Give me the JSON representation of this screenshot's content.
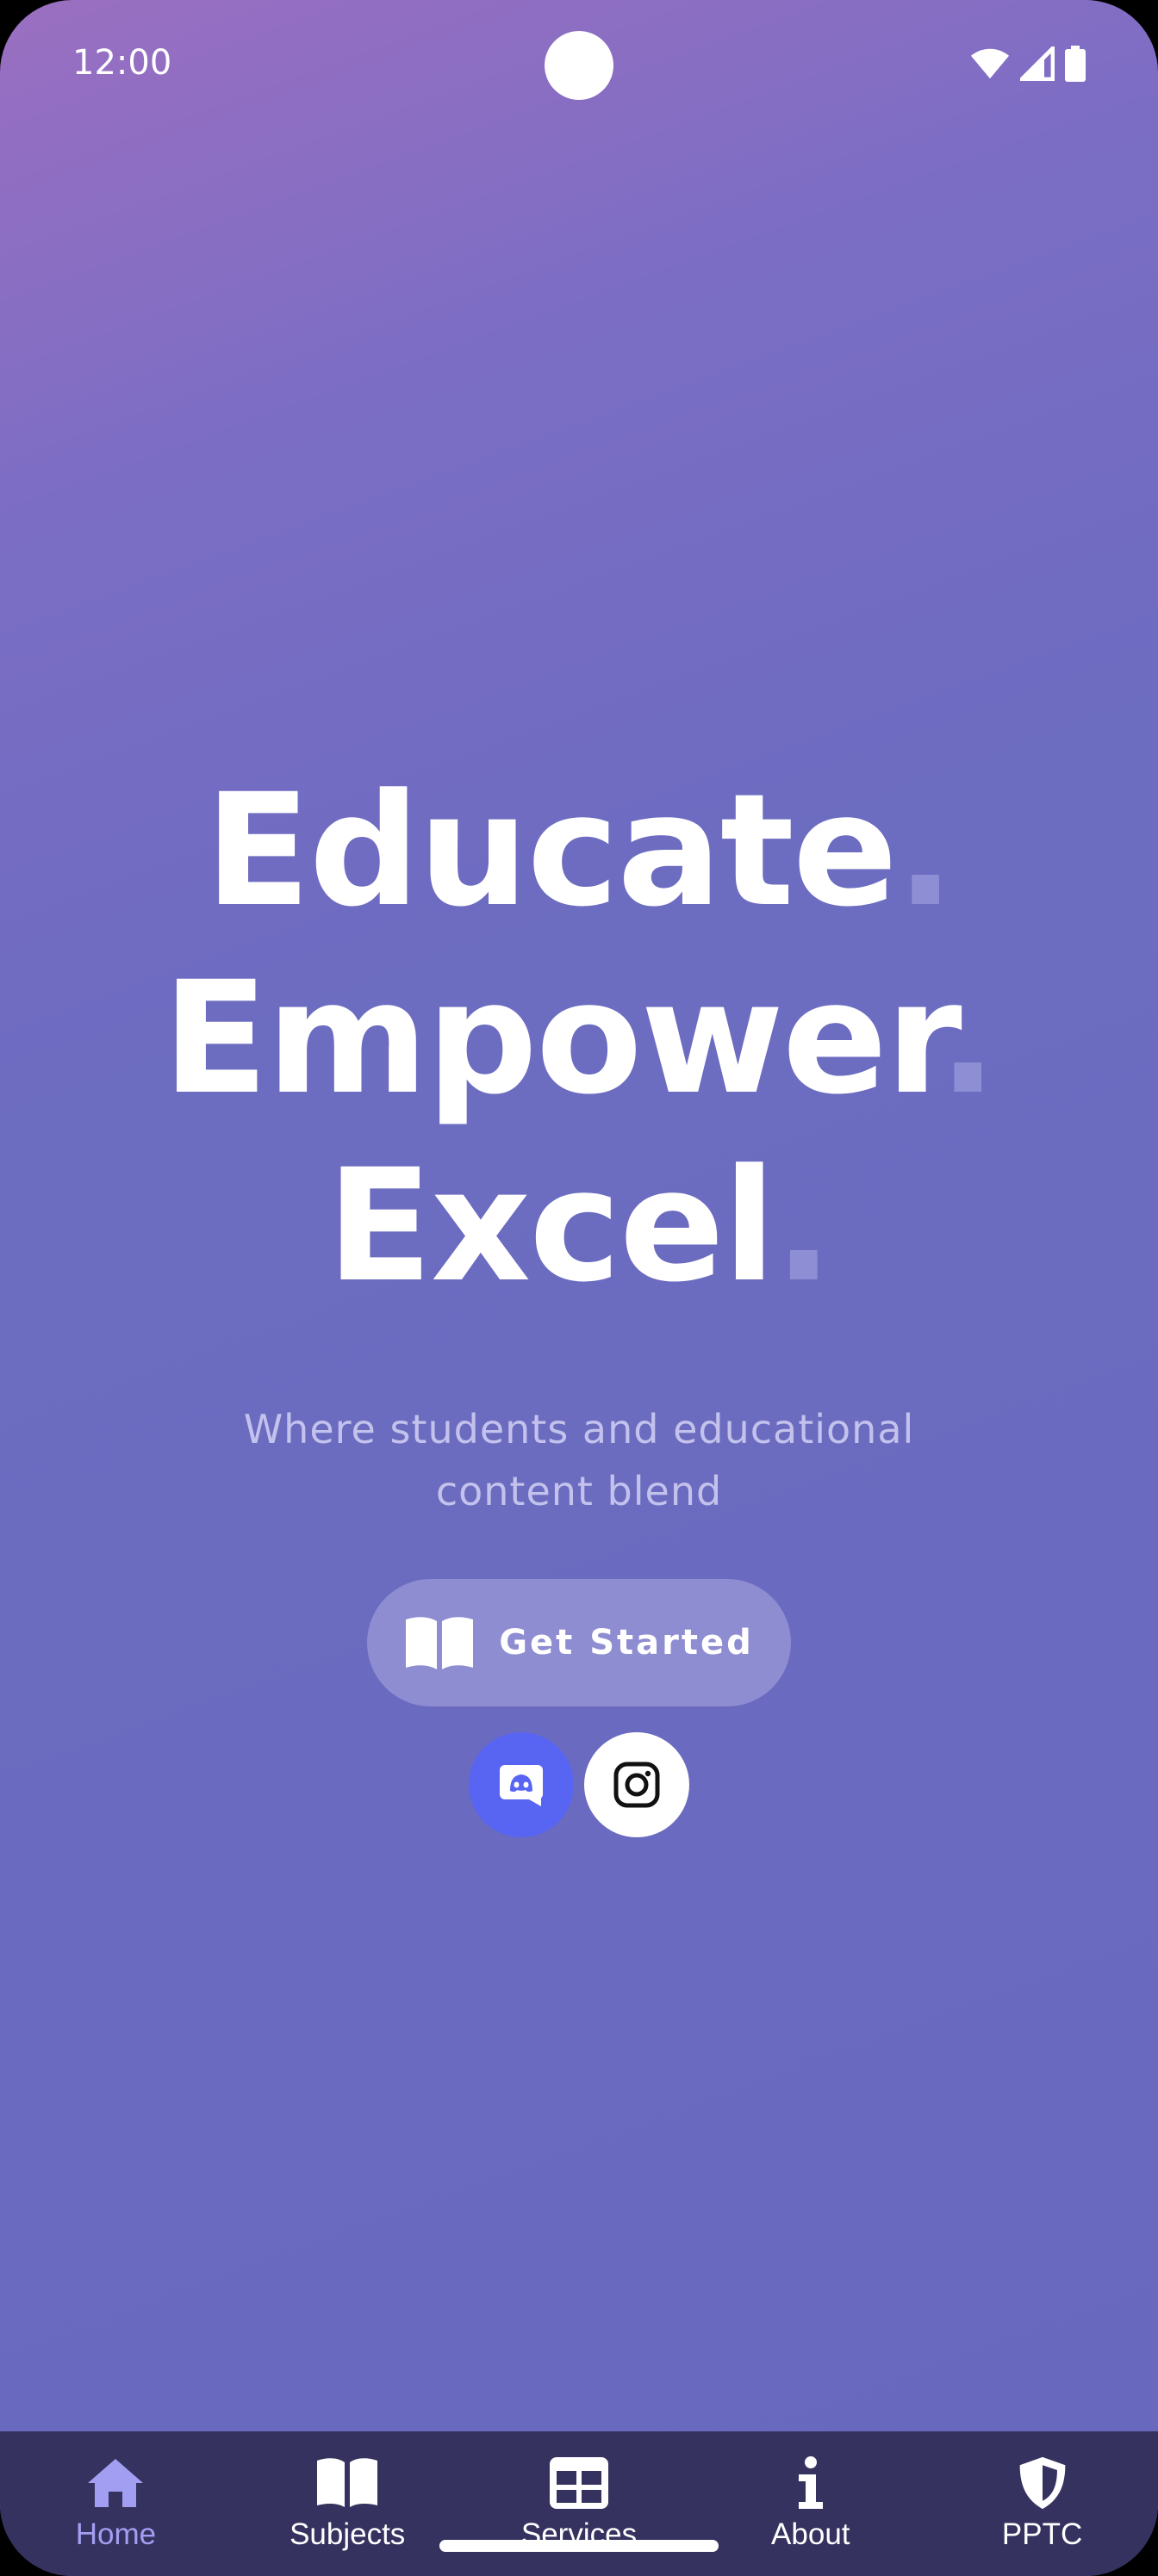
{
  "status_bar": {
    "time": "12:00",
    "icons": [
      "wifi-icon",
      "cellular-signal-icon",
      "battery-icon"
    ]
  },
  "hero": {
    "lines": [
      {
        "word": "Educate",
        "dot": "."
      },
      {
        "word": "Empower",
        "dot": "."
      },
      {
        "word": "Excel",
        "dot": "."
      }
    ],
    "subtitle_line1": "Where students and educational",
    "subtitle_line2": "content blend"
  },
  "cta": {
    "label": "Get Started",
    "icon": "open-book-icon"
  },
  "social": [
    {
      "name": "discord",
      "icon": "discord-icon",
      "color": "#5865f2"
    },
    {
      "name": "instagram",
      "icon": "instagram-icon",
      "color": "#ffffff"
    }
  ],
  "bottom_nav": {
    "items": [
      {
        "label": "Home",
        "icon": "home-icon",
        "active": true
      },
      {
        "label": "Subjects",
        "icon": "book-icon",
        "active": false
      },
      {
        "label": "Services",
        "icon": "table-icon",
        "active": false
      },
      {
        "label": "About",
        "icon": "info-icon",
        "active": false
      },
      {
        "label": "PPTC",
        "icon": "shield-icon",
        "active": false
      }
    ]
  },
  "colors": {
    "gradient_top": "#9a6fc1",
    "gradient_bottom": "#6868bf",
    "accent_dot": "#8d8ed3",
    "nav_background": "#36325f",
    "nav_active": "#a29ef2",
    "cta_background": "#8f8dd2"
  }
}
